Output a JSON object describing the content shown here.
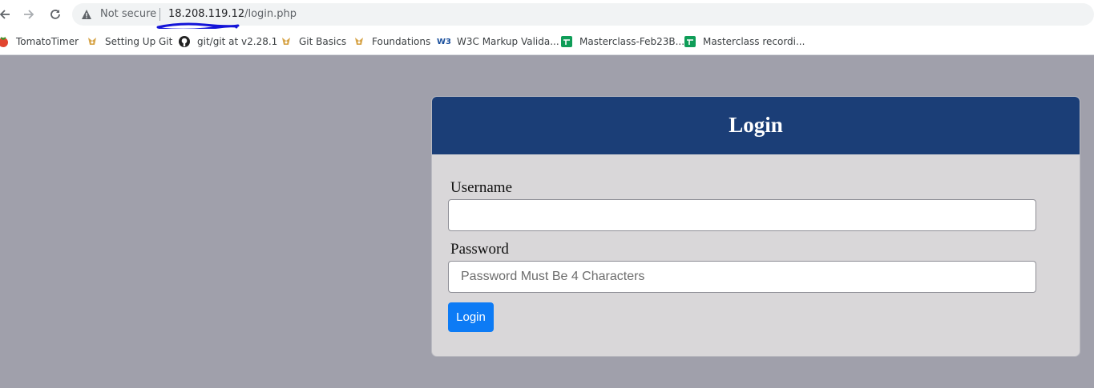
{
  "browser": {
    "security_label": "Not secure",
    "url_host": "18.208.119.12",
    "url_path": "/login.php"
  },
  "bookmarks": [
    {
      "label": "TomatoTimer",
      "icon": "tomato-icon"
    },
    {
      "label": "Setting Up Git",
      "icon": "odin-project-icon"
    },
    {
      "label": "git/git at v2.28.1",
      "icon": "github-icon"
    },
    {
      "label": "Git Basics",
      "icon": "odin-project-icon"
    },
    {
      "label": "Foundations",
      "icon": "odin-project-icon"
    },
    {
      "label": "W3C Markup Valida...",
      "icon": "w3c-icon"
    },
    {
      "label": "Masterclass-Feb23B...",
      "icon": "google-sheets-icon"
    },
    {
      "label": "Masterclass recordi...",
      "icon": "google-sheets-icon"
    }
  ],
  "login": {
    "title": "Login",
    "username_label": "Username",
    "username_value": "",
    "password_label": "Password",
    "password_placeholder": "Password Must Be 4 Characters",
    "submit_label": "Login"
  },
  "colors": {
    "page_bg": "#a0a0ab",
    "header_bg": "#1b3e77",
    "card_bg": "#d9d7d9",
    "button_bg": "#0d7bf5"
  }
}
